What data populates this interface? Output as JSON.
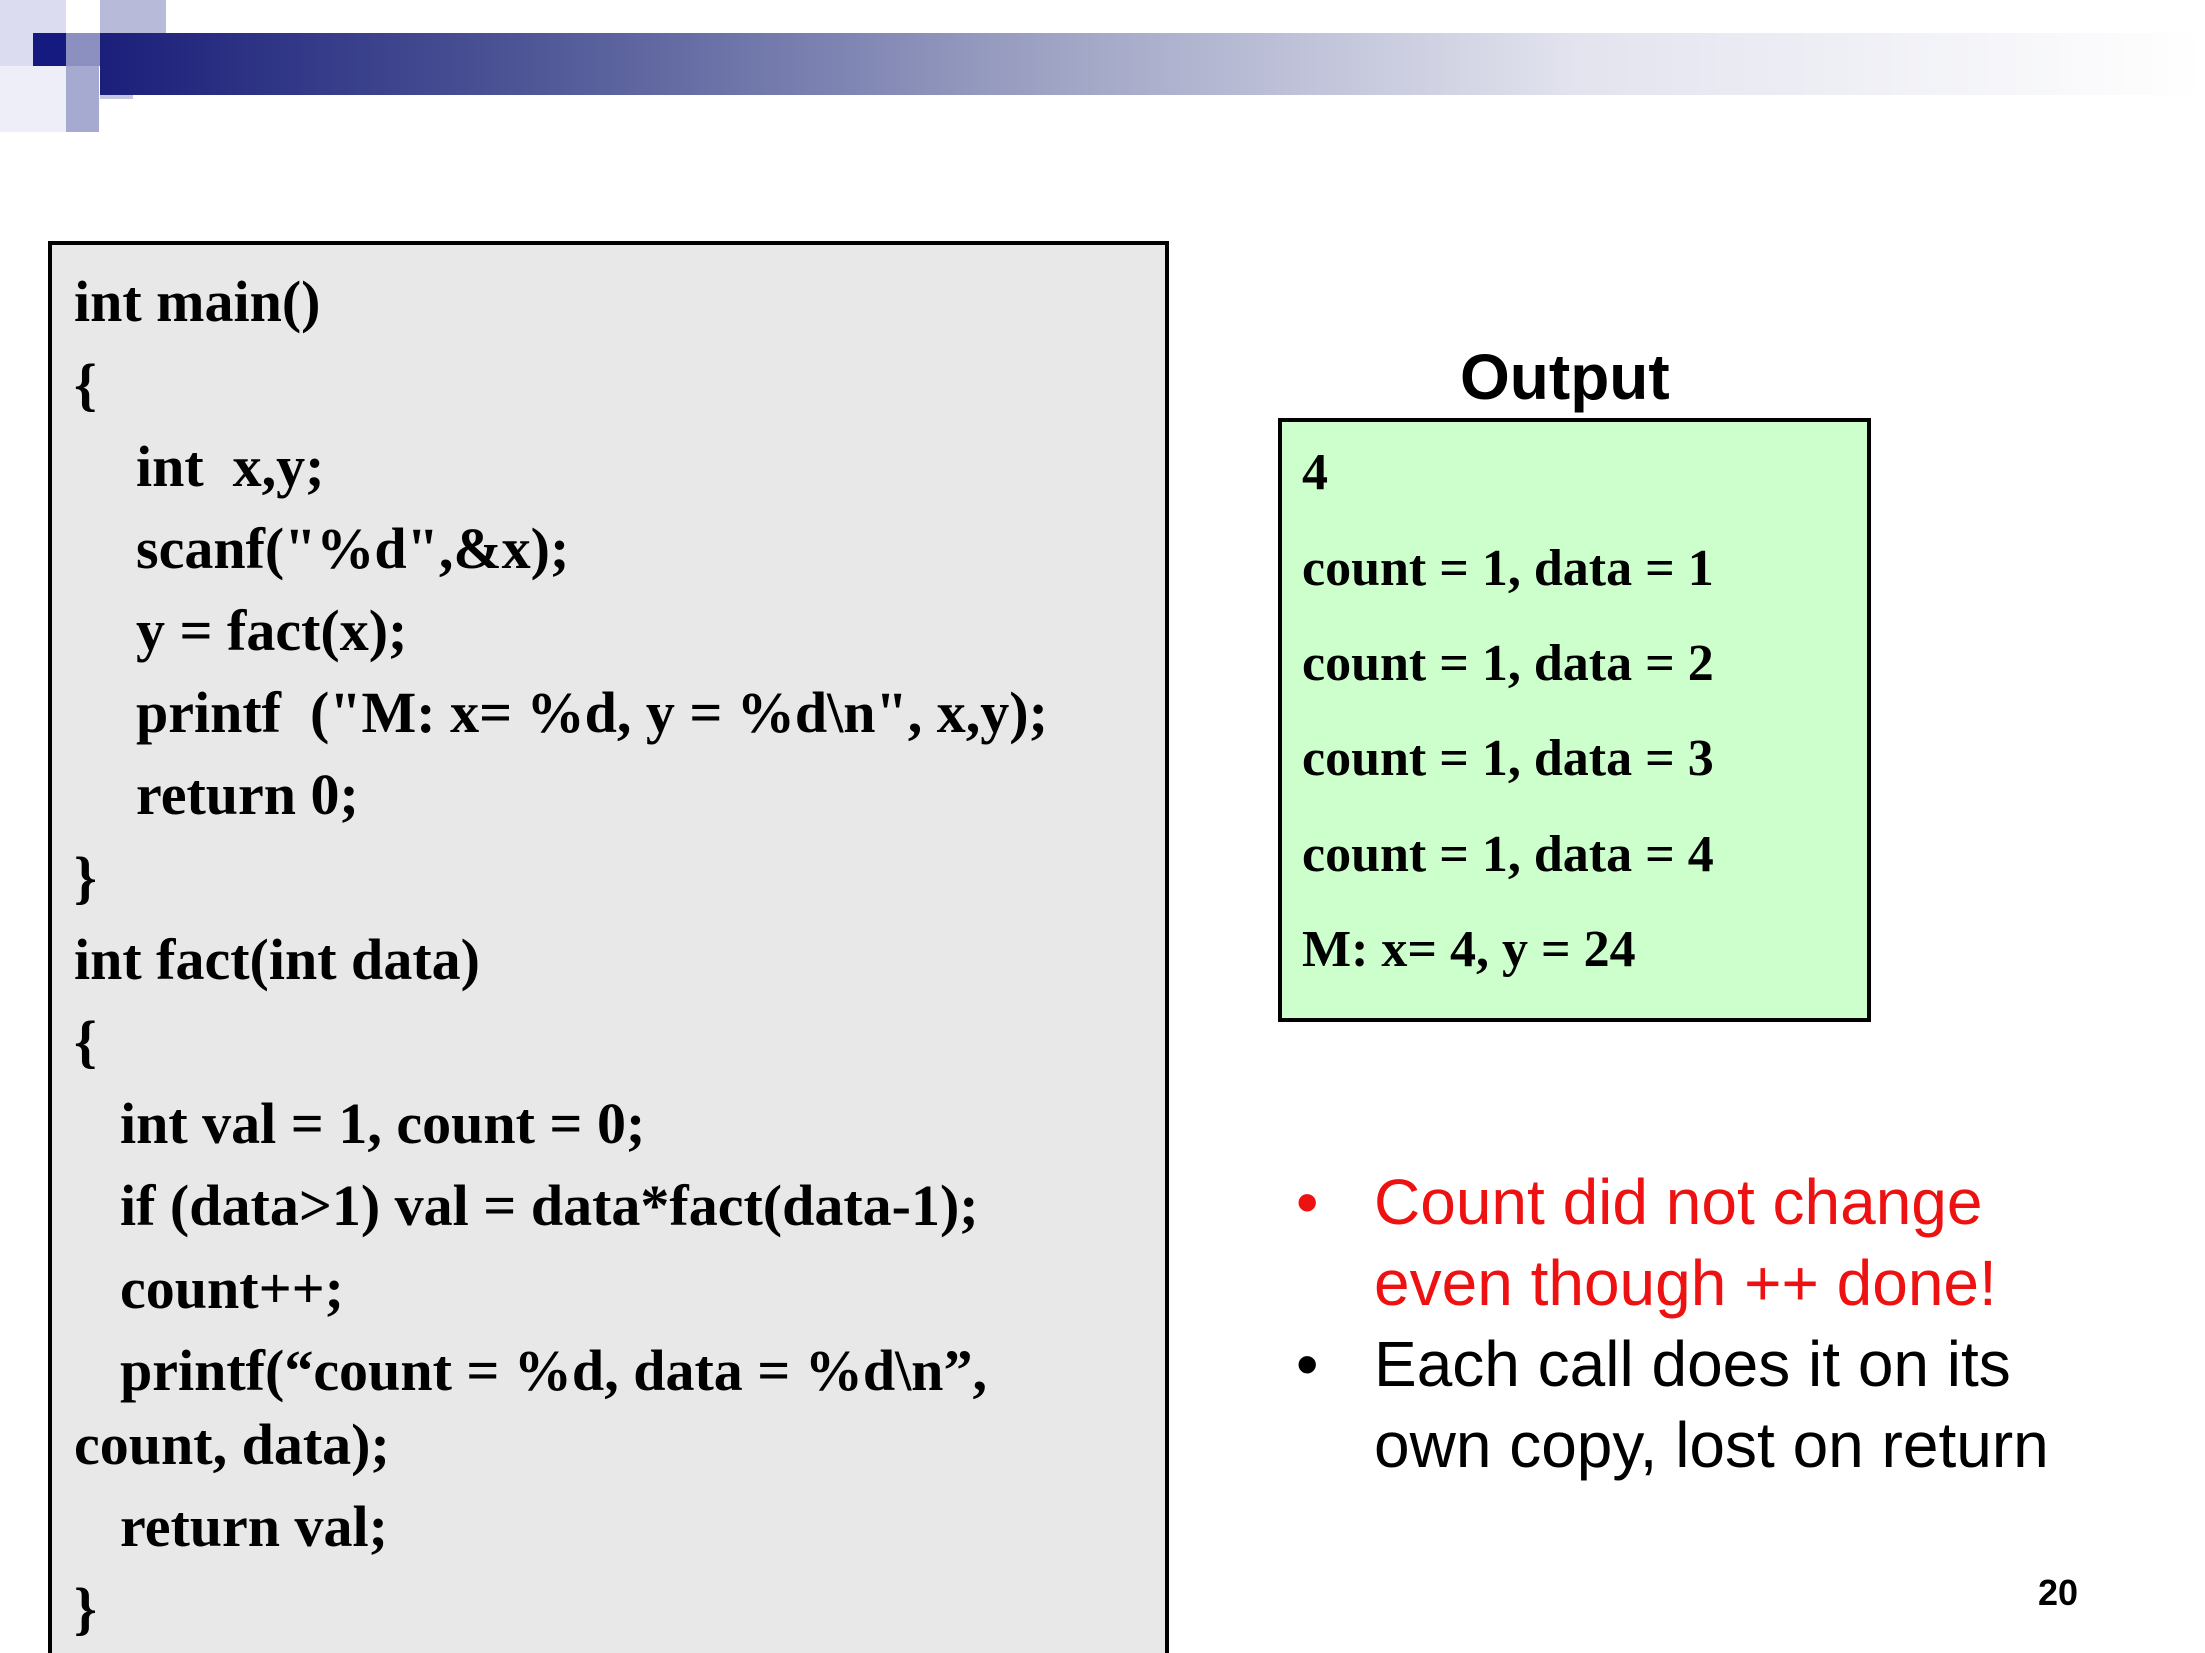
{
  "code_panel": {
    "lines": [
      "int main()",
      "{",
      "int  x,y;",
      "scanf(\"%d\",&x);",
      "y = fact(x);",
      "printf  (\"M: x= %d, y = %d\\n\", x,y);",
      "return 0;",
      "}",
      "int fact(int data)",
      "{",
      "int val = 1, count = 0;",
      "if (data>1) val = data*fact(data-1);",
      "count++;",
      "printf(“count = %d, data = %d\\n”,",
      "count, data);",
      "return val;",
      "}"
    ]
  },
  "output_panel": {
    "title": "Output",
    "lines": [
      "4",
      "count = 1, data = 1",
      "count = 1, data = 2",
      "count = 1, data = 3",
      "count = 1, data = 4",
      "M: x= 4, y = 24"
    ],
    "background_color": "#ccffcc"
  },
  "notes": {
    "bullet_symbol": "•",
    "items": [
      {
        "lines": [
          "Count did not change",
          "even though ++ done!"
        ],
        "color": "#ee1111"
      },
      {
        "lines": [
          "Each call does it on its",
          "own copy, lost on return"
        ],
        "color": "#000000"
      }
    ]
  },
  "page_number": "20",
  "colors": {
    "header_gradient_start": "#1b1f7a",
    "code_background": "#e8e8e8",
    "emphasis_red": "#ee1111"
  }
}
